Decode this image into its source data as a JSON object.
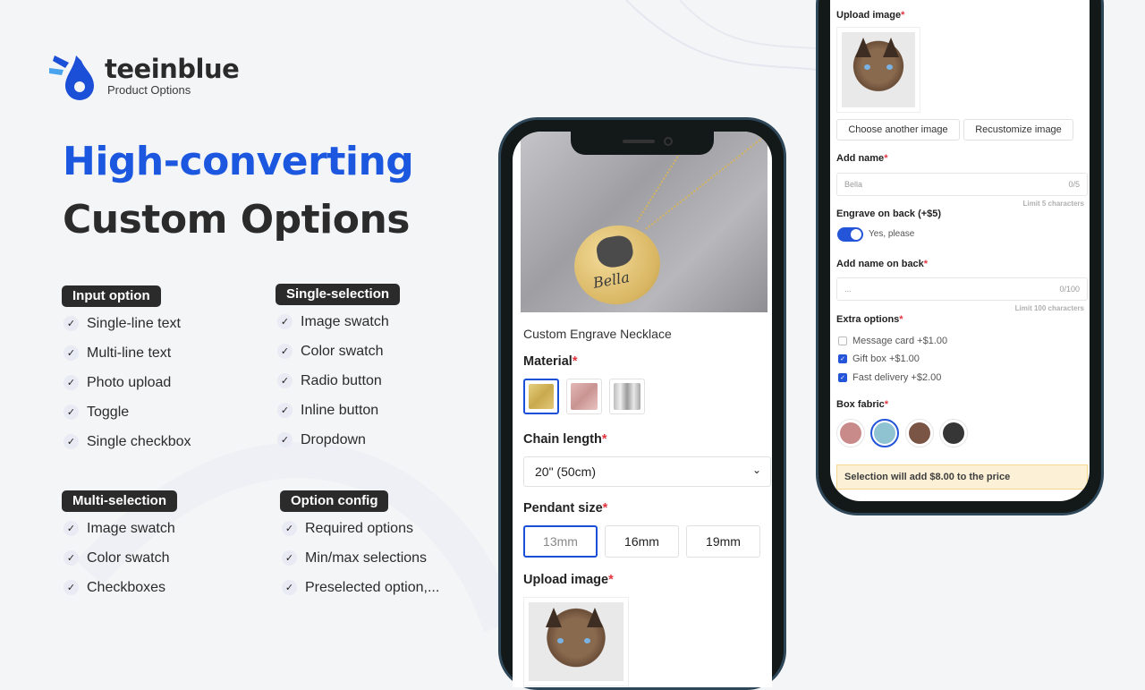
{
  "brand": {
    "name": "teeinblue",
    "subtitle": "Product Options",
    "accent": "#1c57e0"
  },
  "headline": {
    "line1": "High-converting",
    "line2": "Custom Options"
  },
  "groups": [
    {
      "title": "Input option",
      "items": [
        "Single-line text",
        "Multi-line text",
        "Photo upload",
        "Toggle",
        "Single checkbox"
      ]
    },
    {
      "title": "Single-selection",
      "items": [
        "Image swatch",
        "Color swatch",
        "Radio button",
        "Inline button",
        "Dropdown"
      ]
    },
    {
      "title": "Multi-selection",
      "items": [
        "Image swatch",
        "Color swatch",
        "Checkboxes"
      ]
    },
    {
      "title": "Option config",
      "items": [
        "Required options",
        "Min/max selections",
        "Preselected option,..."
      ]
    }
  ],
  "phone1": {
    "engraving_name": "Bella",
    "product_title": "Custom Engrave Necklace",
    "material_label": "Material",
    "materials": [
      {
        "name": "Gold",
        "selected": true
      },
      {
        "name": "Rose gold",
        "selected": false
      },
      {
        "name": "Silver",
        "selected": false
      }
    ],
    "chain_label": "Chain length",
    "chain_value": "20\" (50cm)",
    "pendant_label": "Pendant size",
    "pendant_sizes": [
      {
        "label": "13mm",
        "selected": true
      },
      {
        "label": "16mm",
        "selected": false
      },
      {
        "label": "19mm",
        "selected": false
      }
    ],
    "upload_label": "Upload image",
    "required_mark": "*"
  },
  "phone2": {
    "upload_label": "Upload image",
    "choose_btn": "Choose another image",
    "recustomize_btn": "Recustomize image",
    "add_name_label": "Add name",
    "add_name_placeholder": "Bella",
    "add_name_count": "0/5",
    "add_name_hint": "Limit 5 characters",
    "engrave_label": "Engrave on back (+$5)",
    "engrave_toggle_text": "Yes, please",
    "engrave_on": true,
    "back_name_label": "Add name on back",
    "back_name_placeholder": "...",
    "back_name_count": "0/100",
    "back_name_hint": "Limit 100 characters",
    "extra_label": "Extra options",
    "extras": [
      {
        "label": "Message card +$1.00",
        "checked": false
      },
      {
        "label": "Gift box +$1.00",
        "checked": true
      },
      {
        "label": "Fast delivery +$2.00",
        "checked": true
      }
    ],
    "fabric_label": "Box fabric",
    "fabrics": [
      {
        "color": "#c98a8a",
        "selected": false
      },
      {
        "color": "#8fc3d2",
        "selected": true
      },
      {
        "color": "#7a5444",
        "selected": false
      },
      {
        "color": "#363636",
        "selected": false
      }
    ],
    "notice": "Selection will add $8.00 to the price",
    "required_mark": "*"
  }
}
